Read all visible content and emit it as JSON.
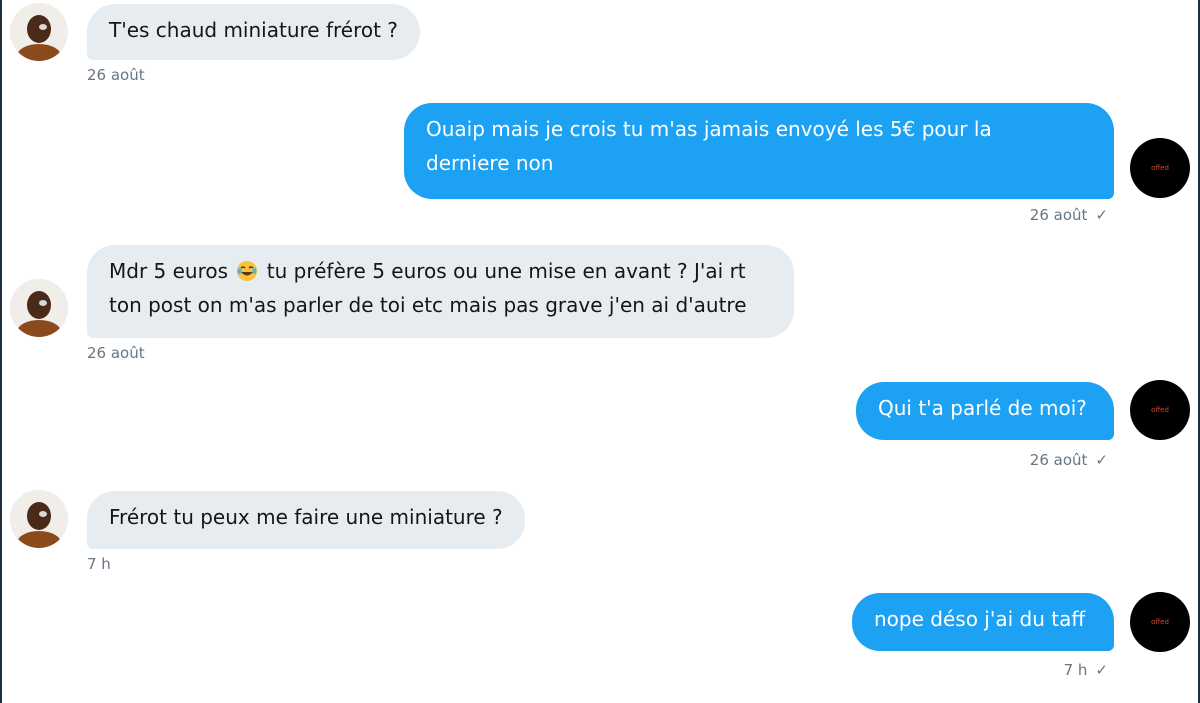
{
  "messages": [
    {
      "direction": "in",
      "text": "T'es chaud miniature frérot ?",
      "time": "26 août"
    },
    {
      "direction": "out",
      "text_line1": "Ouaip mais je crois tu m'as jamais envoyé les 5€ pour la",
      "text_line2": "derniere non",
      "time": "26 août"
    },
    {
      "direction": "in",
      "text_before_emoji": "Mdr 5 euros",
      "emoji": "face-with-tears-of-joy",
      "text_after_emoji": "tu préfère 5 euros ou une mise en avant ? J'ai rt",
      "text_line2": "ton post on m'as parler de toi etc mais pas grave j'en ai d'autre",
      "time": "26 août"
    },
    {
      "direction": "out",
      "text": "Qui t'a parlé de moi?",
      "time": "26 août"
    },
    {
      "direction": "in",
      "text": "Frérot tu peux me faire une miniature ?",
      "time": "7 h"
    },
    {
      "direction": "out",
      "text": "nope déso j'ai du taff",
      "time": "7 h"
    }
  ],
  "own_avatar_label": "offed",
  "read_check": "✓",
  "colors": {
    "incoming_bubble": "#e6ecf0",
    "outgoing_bubble": "#1da1f2",
    "timestamp": "#657786"
  }
}
